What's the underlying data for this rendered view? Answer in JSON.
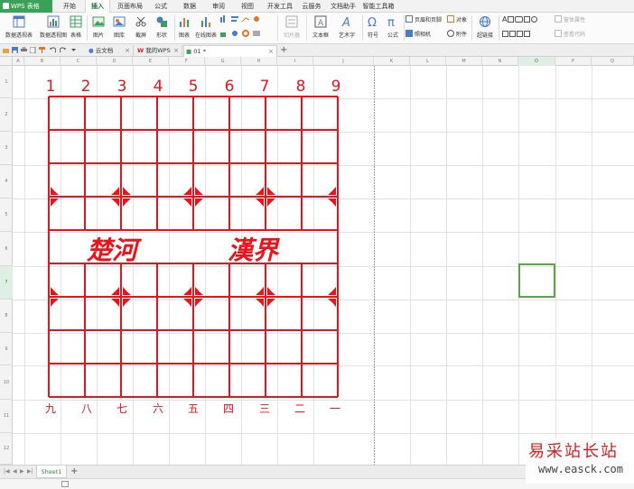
{
  "app": {
    "name": "WPS 表格",
    "menu_tabs": [
      "开始",
      "插入",
      "页面布局",
      "公式",
      "数据",
      "审阅",
      "视图",
      "开发工具",
      "云服务",
      "文档助手",
      "智能工具箱"
    ],
    "active_tab": "插入"
  },
  "ribbon": {
    "groups": [
      {
        "label": "数据透视表"
      },
      {
        "label": "数据透视图"
      },
      {
        "label": "表格"
      },
      {
        "label": "图片"
      },
      {
        "label": "图库"
      },
      {
        "label": "截屏"
      },
      {
        "label": "形状"
      },
      {
        "label": "图表"
      },
      {
        "label": "在线图表"
      },
      {
        "label": "切片器"
      },
      {
        "label": "文本框"
      },
      {
        "label": "艺术字"
      },
      {
        "label": "符号"
      },
      {
        "label": "公式"
      },
      {
        "label": "页眉和页脚"
      },
      {
        "label": "对象"
      },
      {
        "label": "照相机"
      },
      {
        "label": "附件"
      },
      {
        "label": "超链接"
      },
      {
        "label": "窗体属性"
      },
      {
        "label": "查看代码"
      }
    ]
  },
  "doc_tabs": [
    {
      "label": "云文档"
    },
    {
      "label": "我的WPS"
    },
    {
      "label": "01 *"
    }
  ],
  "sheet": {
    "columns": [
      "A",
      "B",
      "C",
      "D",
      "E",
      "F",
      "G",
      "H",
      "I",
      "J",
      "K",
      "L",
      "M",
      "N",
      "O",
      "P",
      "Q"
    ],
    "rows": [
      "1",
      "2",
      "3",
      "4",
      "5",
      "6",
      "7",
      "8",
      "9",
      "10",
      "11",
      "12"
    ],
    "selected_cell": "O7",
    "tabs": [
      {
        "label": "Sheet1"
      }
    ]
  },
  "board": {
    "top_numbers": [
      "1",
      "2",
      "3",
      "4",
      "5",
      "6",
      "7",
      "8",
      "9"
    ],
    "bottom_numbers": [
      "九",
      "八",
      "七",
      "六",
      "五",
      "四",
      "三",
      "二",
      "一"
    ],
    "river_left": "楚河",
    "river_right": "漢界",
    "line_color": "#e8131b"
  },
  "watermark": {
    "text": "易采站长站",
    "url": "www.easck.com"
  }
}
